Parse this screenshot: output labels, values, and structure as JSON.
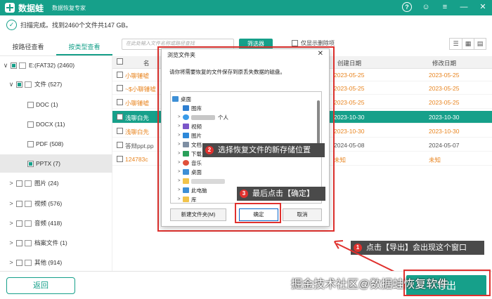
{
  "app": {
    "name": "数据蛙",
    "subtitle": "数据恢复专家",
    "help_glyph": "?",
    "user_glyph": "☺",
    "menu_glyph": "≡",
    "min_glyph": "—",
    "close_glyph": "✕"
  },
  "status": {
    "text": "扫描完成。找到2460个文件共147 GB。"
  },
  "tabs": [
    {
      "label": "按路径查看"
    },
    {
      "label": "按类型查看"
    }
  ],
  "toolbar": {
    "search_placeholder": "在此处输入文件名称或路径查找",
    "filter_label": "筛选器",
    "only_deleted_label": "仅显示删除项"
  },
  "tree": [
    {
      "label": "E:(FAT32) (2460)",
      "chevron": "∨"
    },
    {
      "label": "文件 (527)",
      "chevron": "∨"
    },
    {
      "label": "DOC (1)",
      "chevron": ""
    },
    {
      "label": "DOCX (11)",
      "chevron": ""
    },
    {
      "label": "PDF (508)",
      "chevron": ""
    },
    {
      "label": "PPTX (7)",
      "chevron": ""
    },
    {
      "label": "图片 (24)",
      "chevron": ">"
    },
    {
      "label": "视频 (576)",
      "chevron": ">"
    },
    {
      "label": "音频 (418)",
      "chevron": ">"
    },
    {
      "label": "档案文件 (1)",
      "chevron": ">"
    },
    {
      "label": "其他 (914)",
      "chevron": ">"
    }
  ],
  "table": {
    "headers": {
      "name": "名",
      "created": "创建日期",
      "modified": "修改日期"
    },
    "rows": [
      {
        "name": "小聊锤嘘",
        "created": "2023-05-25",
        "modified": "2023-05-25"
      },
      {
        "name": "~$小聊锤嘘",
        "created": "2023-05-25",
        "modified": "2023-05-25"
      },
      {
        "name": "小聊锤嘘",
        "created": "2023-05-25",
        "modified": "2023-05-25"
      },
      {
        "name": "浅聊白先",
        "created": "2023-10-30",
        "modified": "2023-10-30"
      },
      {
        "name": "浅聊白先",
        "created": "2023-10-30",
        "modified": "2023-10-30"
      },
      {
        "name": "答辩ppt.pp",
        "created": "2024-05-08",
        "modified": "2024-05-07"
      },
      {
        "name": "124783c",
        "created": "未知",
        "modified": "未知"
      }
    ]
  },
  "dialog": {
    "title": "浏览文件夹",
    "close_glyph": "✕",
    "prompt": "请你将需要恢复的文件保存到原丢失数据的磁盘。",
    "nodes": [
      {
        "label": "桌面"
      },
      {
        "label": "图库"
      },
      {
        "label": "个人"
      },
      {
        "label": "视频"
      },
      {
        "label": "图片"
      },
      {
        "label": "文档"
      },
      {
        "label": "下载"
      },
      {
        "label": "音乐"
      },
      {
        "label": "桌面"
      },
      {
        "label": ""
      },
      {
        "label": "此电脑"
      },
      {
        "label": "库"
      }
    ],
    "new_folder_label": "新建文件夹(M)",
    "ok_label": "确定",
    "cancel_label": "取消"
  },
  "callouts": [
    {
      "number": "1",
      "text": "点击【导出】会出现这个窗口"
    },
    {
      "number": "2",
      "text": "选择恢复文件的新存储位置"
    },
    {
      "number": "3",
      "text": "最后点击【确定】"
    }
  ],
  "footer": {
    "back_label": "返回",
    "export_label": "导出"
  },
  "watermark": "掘金技术社区@数据蛙恢复软件",
  "colors": {
    "brand": "#16a08a",
    "accent_red": "#e0312e",
    "deleted_orange": "#e8841f"
  }
}
